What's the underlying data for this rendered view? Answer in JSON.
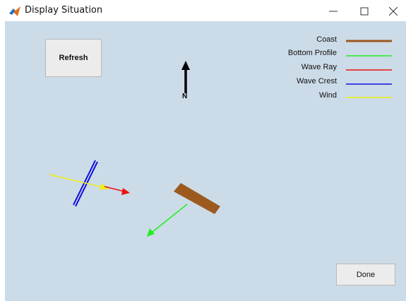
{
  "window": {
    "title": "Display Situation",
    "icon": "matlab-icon"
  },
  "controls": {
    "refresh_label": "Refresh",
    "done_label": "Done"
  },
  "compass": {
    "north_label": "N"
  },
  "legend": [
    {
      "label": "Coast",
      "color": "#9c5a1e"
    },
    {
      "label": "Bottom Profile",
      "color": "#22ee22"
    },
    {
      "label": "Wave Ray",
      "color": "#ee1111"
    },
    {
      "label": "Wave Crest",
      "color": "#1111dd"
    },
    {
      "label": "Wind",
      "color": "#eeee11"
    }
  ],
  "colors": {
    "background": "#ccdbe8",
    "coast": "#9c5a1e",
    "bottom_profile": "#22ee22",
    "wave_ray": "#ee1111",
    "wave_crest": "#1111dd",
    "wind": "#eeee11"
  }
}
